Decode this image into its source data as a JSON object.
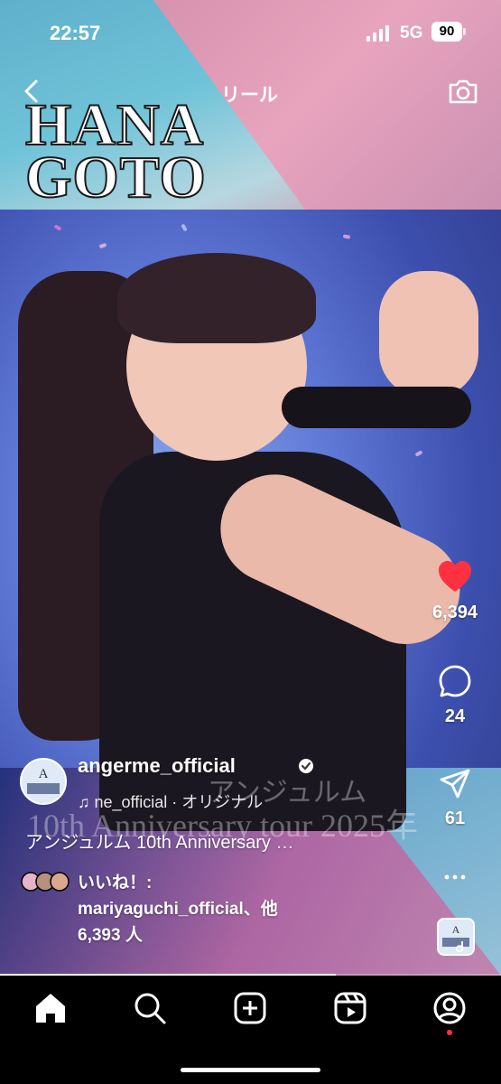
{
  "status_bar": {
    "time": "22:57",
    "network": "5G",
    "battery": "90"
  },
  "header": {
    "title": "リール"
  },
  "video": {
    "logo_line1": "HANA",
    "logo_line2": "GOTO",
    "watermark_jp": "アンジュルム",
    "watermark_en": "10th Anniversary tour 2025年",
    "progress": 0.67
  },
  "actions": {
    "likes": "6,394",
    "comments": "24",
    "shares": "61",
    "liked": true,
    "like_color": "#ff3040"
  },
  "post": {
    "username": "angerme_official",
    "verified": true,
    "audio": "ne_official · オリジナル",
    "caption": "アンジュルム 10th Anniversary …",
    "likes_line1": "いいね！:",
    "likes_line2": "mariyaguchi_official、他",
    "likes_line3": "6,393 人"
  },
  "tabs": [
    {
      "name": "home",
      "icon": "home-icon",
      "active": true
    },
    {
      "name": "search",
      "icon": "search-icon"
    },
    {
      "name": "create",
      "icon": "add-square-icon"
    },
    {
      "name": "reels",
      "icon": "reels-icon"
    },
    {
      "name": "profile",
      "icon": "profile-icon",
      "notification": true
    }
  ]
}
